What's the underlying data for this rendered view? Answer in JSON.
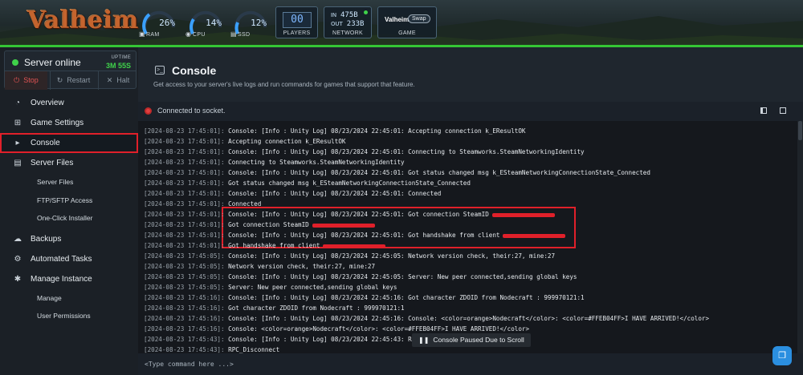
{
  "header": {
    "logo_text": "Valheim",
    "gauges": [
      {
        "label": "RAM",
        "value": "26%",
        "icon": "chip-icon"
      },
      {
        "label": "CPU",
        "value": "14%",
        "icon": "cpu-icon"
      },
      {
        "label": "SSD",
        "value": "12%",
        "icon": "disk-icon"
      }
    ],
    "players": {
      "label": "PLAYERS",
      "value": "00"
    },
    "network": {
      "label": "NETWORK",
      "in_label": "IN",
      "in_value": "475B",
      "out_label": "OUT",
      "out_value": "233B"
    },
    "game": {
      "label": "GAME",
      "name": "Valheim",
      "swap_label": "Swap"
    }
  },
  "sidebar": {
    "status_text": "Server online",
    "uptime_label": "UPTIME",
    "uptime_value": "3M 55S",
    "stop_label": "Stop",
    "restart_label": "Restart",
    "halt_label": "Halt",
    "items": [
      {
        "label": "Overview",
        "icon": "gauge-icon"
      },
      {
        "label": "Game Settings",
        "icon": "gamepad-icon"
      },
      {
        "label": "Console",
        "icon": "terminal-icon",
        "active": true
      },
      {
        "label": "Server Files",
        "icon": "file-icon"
      },
      {
        "label": "Server Files",
        "sub": true
      },
      {
        "label": "FTP/SFTP Access",
        "sub": true
      },
      {
        "label": "One-Click Installer",
        "sub": true
      },
      {
        "label": "Backups",
        "icon": "cloud-icon"
      },
      {
        "label": "Automated Tasks",
        "icon": "tasks-icon"
      },
      {
        "label": "Manage Instance",
        "icon": "gear-icon"
      },
      {
        "label": "Manage",
        "sub": true
      },
      {
        "label": "User Permissions",
        "sub": true
      }
    ]
  },
  "main": {
    "title": "Console",
    "subtitle": "Get access to your server's live logs and run commands for games that support that feature.",
    "socket_status": "Connected to socket.",
    "paused_text": "Console Paused Due to Scroll",
    "command_placeholder": "<Type command here ...>",
    "log_lines": [
      {
        "ts": "[2024-08-23 17:45:01]:",
        "text": " Console: [Info   : Unity Log] 08/23/2024 22:45:01: Accepting connection k_EResultOK"
      },
      {
        "ts": "[2024-08-23 17:45:01]:",
        "text": " Accepting connection k_EResultOK"
      },
      {
        "ts": "[2024-08-23 17:45:01]:",
        "text": " Console: [Info   : Unity Log] 08/23/2024 22:45:01: Connecting to Steamworks.SteamNetworkingIdentity"
      },
      {
        "ts": "[2024-08-23 17:45:01]:",
        "text": " Connecting to Steamworks.SteamNetworkingIdentity"
      },
      {
        "ts": "[2024-08-23 17:45:01]:",
        "text": " Console: [Info   : Unity Log] 08/23/2024 22:45:01: Got status changed msg k_ESteamNetworkingConnectionState_Connected"
      },
      {
        "ts": "[2024-08-23 17:45:01]:",
        "text": " Got status changed msg k_ESteamNetworkingConnectionState_Connected"
      },
      {
        "ts": "[2024-08-23 17:45:01]:",
        "text": " Console: [Info   : Unity Log] 08/23/2024 22:45:01: Connected"
      },
      {
        "ts": "[2024-08-23 17:45:01]:",
        "text": " Connected"
      },
      {
        "ts": "[2024-08-23 17:45:01]:",
        "text": " Console: [Info   : Unity Log] 08/23/2024 22:45:01: Got connection SteamID",
        "redacted": true
      },
      {
        "ts": "[2024-08-23 17:45:01]:",
        "text": " Got connection SteamID",
        "redacted": true
      },
      {
        "ts": "[2024-08-23 17:45:01]:",
        "text": " Console: [Info   : Unity Log] 08/23/2024 22:45:01: Got handshake from client",
        "redacted": true
      },
      {
        "ts": "[2024-08-23 17:45:01]:",
        "text": " Got handshake from client",
        "redacted": true
      },
      {
        "ts": "[2024-08-23 17:45:05]:",
        "text": " Console: [Info   : Unity Log] 08/23/2024 22:45:05: Network version check, their:27, mine:27"
      },
      {
        "ts": "[2024-08-23 17:45:05]:",
        "text": " Network version check, their:27, mine:27"
      },
      {
        "ts": "[2024-08-23 17:45:05]:",
        "text": " Console: [Info   : Unity Log] 08/23/2024 22:45:05: Server: New peer connected,sending global keys"
      },
      {
        "ts": "[2024-08-23 17:45:05]:",
        "text": " Server: New peer connected,sending global keys"
      },
      {
        "ts": "[2024-08-23 17:45:16]:",
        "text": " Console: [Info   : Unity Log] 08/23/2024 22:45:16: Got character ZDOID from Nodecraft : 999970121:1"
      },
      {
        "ts": "[2024-08-23 17:45:16]:",
        "text": " Got character ZDOID from Nodecraft : 999970121:1"
      },
      {
        "ts": "[2024-08-23 17:45:16]:",
        "text": " Console: [Info   : Unity Log] 08/23/2024 22:45:16: Console: <color=orange>Nodecraft</color>: <color=#FFEB04FF>I HAVE ARRIVED!</color>"
      },
      {
        "ts": "[2024-08-23 17:45:16]:",
        "text": " Console: <color=orange>Nodecraft</color>: <color=#FFEB04FF>I HAVE ARRIVED!</color>"
      },
      {
        "ts": "[2024-08-23 17:45:43]:",
        "text": " Console: [Info   : Unity Log] 08/23/2024 22:45:43: RPC_Disconnect"
      },
      {
        "ts": "[2024-08-23 17:45:43]:",
        "text": " RPC_Disconnect"
      }
    ]
  },
  "colors": {
    "accent_green": "#35c635",
    "online_green": "#3fd24a",
    "alert_red": "#e0202a",
    "help_blue": "#2b8fe0"
  }
}
